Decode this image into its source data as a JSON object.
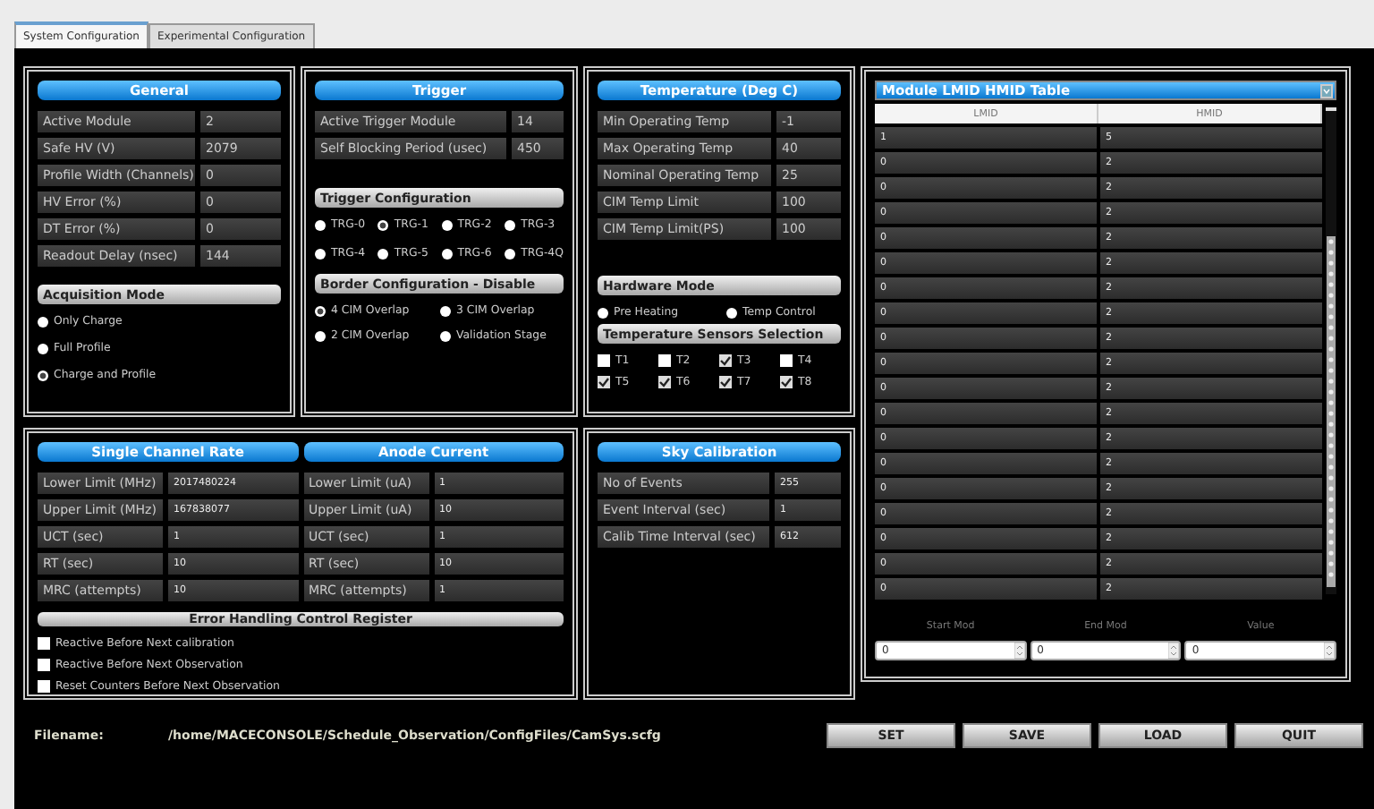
{
  "tabs": [
    {
      "label": "System Configuration",
      "selected": true
    },
    {
      "label": "Experimental Configuration",
      "selected": false
    }
  ],
  "general": {
    "title": "General",
    "fields": [
      {
        "label": "Active Module",
        "value": "2"
      },
      {
        "label": "Safe HV (V)",
        "value": "2079"
      },
      {
        "label": "Profile Width (Channels)",
        "value": "0"
      },
      {
        "label": "HV Error (%)",
        "value": "0"
      },
      {
        "label": "DT Error (%)",
        "value": "0"
      },
      {
        "label": "Readout Delay (nsec)",
        "value": "144"
      }
    ],
    "acquisition_mode": {
      "title": "Acquisition Mode",
      "options": [
        {
          "label": "Only Charge",
          "selected": false
        },
        {
          "label": "Full Profile",
          "selected": false
        },
        {
          "label": "Charge and Profile",
          "selected": true
        }
      ]
    }
  },
  "trigger": {
    "title": "Trigger",
    "fields": [
      {
        "label": "Active Trigger Module",
        "value": "14"
      },
      {
        "label": "Self Blocking Period (usec)",
        "value": "450"
      }
    ],
    "trigger_configuration": {
      "title": "Trigger Configuration",
      "options": [
        {
          "label": "TRG-0",
          "selected": false
        },
        {
          "label": "TRG-1",
          "selected": true
        },
        {
          "label": "TRG-2",
          "selected": false
        },
        {
          "label": "TRG-3",
          "selected": false
        },
        {
          "label": "TRG-4",
          "selected": false
        },
        {
          "label": "TRG-5",
          "selected": false
        },
        {
          "label": "TRG-6",
          "selected": false
        },
        {
          "label": "TRG-4Q",
          "selected": false
        }
      ]
    },
    "border_configuration": {
      "title": "Border Configuration - Disable",
      "options": [
        {
          "label": "4 CIM Overlap",
          "selected": true
        },
        {
          "label": "3 CIM Overlap",
          "selected": false
        },
        {
          "label": "2 CIM Overlap",
          "selected": false
        },
        {
          "label": "Validation Stage",
          "selected": false
        }
      ]
    }
  },
  "temperature": {
    "title": "Temperature (Deg C)",
    "fields": [
      {
        "label": "Min Operating Temp",
        "value": "-1"
      },
      {
        "label": "Max Operating Temp",
        "value": "40"
      },
      {
        "label": "Nominal Operating Temp",
        "value": "25"
      },
      {
        "label": "CIM Temp Limit",
        "value": "100"
      },
      {
        "label": "CIM Temp Limit(PS)",
        "value": "100"
      }
    ],
    "hardware_mode": {
      "title": "Hardware Mode",
      "options": [
        {
          "label": "Pre Heating",
          "selected": false
        },
        {
          "label": "Temp Control",
          "selected": false
        }
      ]
    },
    "sensors": {
      "title": "Temperature Sensors Selection",
      "items": [
        {
          "label": "T1",
          "checked": false
        },
        {
          "label": "T2",
          "checked": false
        },
        {
          "label": "T3",
          "checked": true
        },
        {
          "label": "T4",
          "checked": false
        },
        {
          "label": "T5",
          "checked": true
        },
        {
          "label": "T6",
          "checked": true
        },
        {
          "label": "T7",
          "checked": true
        },
        {
          "label": "T8",
          "checked": true
        }
      ]
    }
  },
  "lmid_hmid_table": {
    "title": "Module LMID HMID Table",
    "columns": [
      "LMID",
      "HMID"
    ],
    "rows": [
      [
        "1",
        "5"
      ],
      [
        "0",
        "2"
      ],
      [
        "0",
        "2"
      ],
      [
        "0",
        "2"
      ],
      [
        "0",
        "2"
      ],
      [
        "0",
        "2"
      ],
      [
        "0",
        "2"
      ],
      [
        "0",
        "2"
      ],
      [
        "0",
        "2"
      ],
      [
        "0",
        "2"
      ],
      [
        "0",
        "2"
      ],
      [
        "0",
        "2"
      ],
      [
        "0",
        "2"
      ],
      [
        "0",
        "2"
      ],
      [
        "0",
        "2"
      ],
      [
        "0",
        "2"
      ],
      [
        "0",
        "2"
      ],
      [
        "0",
        "2"
      ],
      [
        "0",
        "2"
      ]
    ],
    "spinners": [
      {
        "label": "Start Mod",
        "value": "0"
      },
      {
        "label": "End Mod",
        "value": "0"
      },
      {
        "label": "Value",
        "value": "0"
      }
    ]
  },
  "single_channel_rate": {
    "title": "Single Channel Rate",
    "fields": [
      {
        "label": "Lower Limit (MHz)",
        "value": "2017480224"
      },
      {
        "label": "Upper Limit (MHz)",
        "value": "167838077"
      },
      {
        "label": "UCT (sec)",
        "value": "1"
      },
      {
        "label": "RT (sec)",
        "value": "10"
      },
      {
        "label": "MRC (attempts)",
        "value": "10"
      }
    ]
  },
  "anode_current": {
    "title": "Anode Current",
    "fields": [
      {
        "label": "Lower Limit (uA)",
        "value": "1"
      },
      {
        "label": "Upper Limit (uA)",
        "value": "10"
      },
      {
        "label": "UCT (sec)",
        "value": "1"
      },
      {
        "label": "RT (sec)",
        "value": "10"
      },
      {
        "label": "MRC (attempts)",
        "value": "1"
      }
    ]
  },
  "error_handling": {
    "title": "Error Handling Control Register",
    "items": [
      {
        "label": "Reactive Before Next calibration",
        "checked": false
      },
      {
        "label": "Reactive Before Next Observation",
        "checked": false
      },
      {
        "label": "Reset Counters Before Next Observation",
        "checked": false
      }
    ]
  },
  "sky_calibration": {
    "title": "Sky Calibration",
    "fields": [
      {
        "label": "No of Events",
        "value": "255"
      },
      {
        "label": "Event Interval (sec)",
        "value": "1"
      },
      {
        "label": "Calib Time Interval (sec)",
        "value": "612"
      }
    ]
  },
  "filename": {
    "label": "Filename:",
    "value": "/home/MACECONSOLE/Schedule_Observation/ConfigFiles/CamSys.scfg"
  },
  "buttons": [
    "SET",
    "SAVE",
    "LOAD",
    "QUIT"
  ]
}
